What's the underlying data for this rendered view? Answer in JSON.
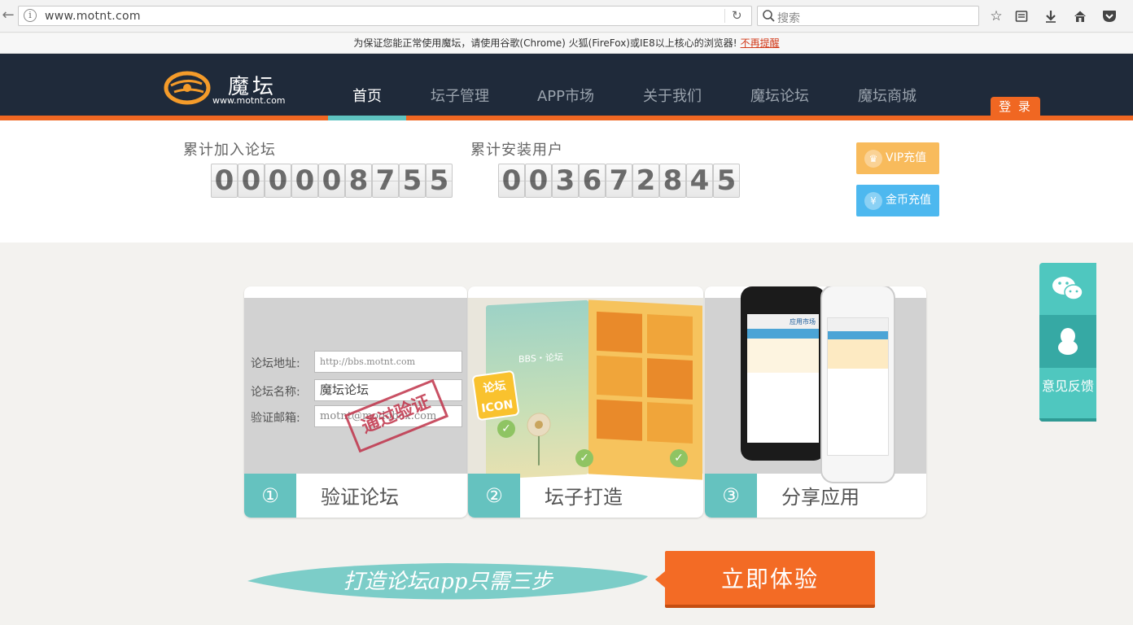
{
  "browser": {
    "url": "www.motnt.com",
    "search_placeholder": "搜索"
  },
  "notice": {
    "text": "为保证您能正常使用魔坛，请使用谷歌(Chrome) 火狐(FireFox)或IE8以上核心的浏览器!",
    "dismiss": "不再提醒"
  },
  "header": {
    "logo_title": "魔坛",
    "logo_url": "www.motnt.com",
    "nav": [
      "首页",
      "坛子管理",
      "APP市场",
      "关于我们",
      "魔坛论坛",
      "魔坛商城"
    ],
    "login": "登 录"
  },
  "stats": {
    "forums_label": "累计加入论坛",
    "forums_digits": [
      "0",
      "0",
      "0",
      "0",
      "0",
      "8",
      "7",
      "5",
      "5"
    ],
    "users_label": "累计安装用户",
    "users_digits": [
      "0",
      "0",
      "3",
      "6",
      "7",
      "2",
      "8",
      "4",
      "5"
    ],
    "vip_label": "VIP充值",
    "gold_label": "金币充值"
  },
  "steps": [
    {
      "num": "①",
      "title": "验证论坛"
    },
    {
      "num": "②",
      "title": "坛子打造"
    },
    {
      "num": "③",
      "title": "分享应用"
    }
  ],
  "step1_form": {
    "address_label": "论坛地址:",
    "address_value": "http://bbs.motnt.com",
    "name_label": "论坛名称:",
    "name_value": "魔坛论坛",
    "email_label": "验证邮箱:",
    "email_value": "motnt@modobox.com",
    "stamp": "通过验证"
  },
  "step2_mock": {
    "bbs_text": "BBS・论坛",
    "badge": "论坛 ICON"
  },
  "step3_mock": {
    "app_title": "应用市场"
  },
  "feedback": {
    "label": "意见反馈"
  },
  "cta": {
    "slogan": "打造论坛app只需三步",
    "button": "立即体验"
  },
  "colors": {
    "header_bg": "#1f2a3a",
    "accent_orange": "#f06722",
    "accent_teal": "#5ec3c0",
    "vip": "#f8bb5c",
    "gold": "#4db8ef"
  }
}
